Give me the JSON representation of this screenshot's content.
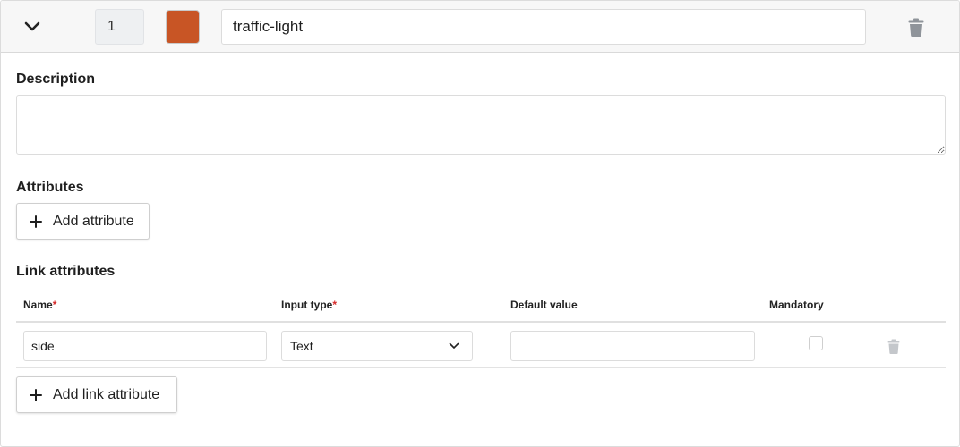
{
  "header": {
    "order": "1",
    "color": "#c85525",
    "name_value": "traffic-light",
    "collapse_icon": "chevron-down-icon",
    "delete_icon": "trash-icon"
  },
  "description": {
    "label": "Description",
    "value": ""
  },
  "attributes": {
    "label": "Attributes",
    "add_button": "Add attribute"
  },
  "link_attributes": {
    "label": "Link attributes",
    "columns": {
      "name": "Name",
      "input_type": "Input type",
      "default_value": "Default value",
      "mandatory": "Mandatory"
    },
    "required_marker": "*",
    "rows": [
      {
        "name": "side",
        "input_type": "Text",
        "default_value": "",
        "mandatory": false
      }
    ],
    "add_button": "Add link attribute"
  },
  "colors": {
    "header_bg": "#f7f7f7",
    "required": "#d62a2a",
    "icon_muted": "#9ca0a6"
  }
}
